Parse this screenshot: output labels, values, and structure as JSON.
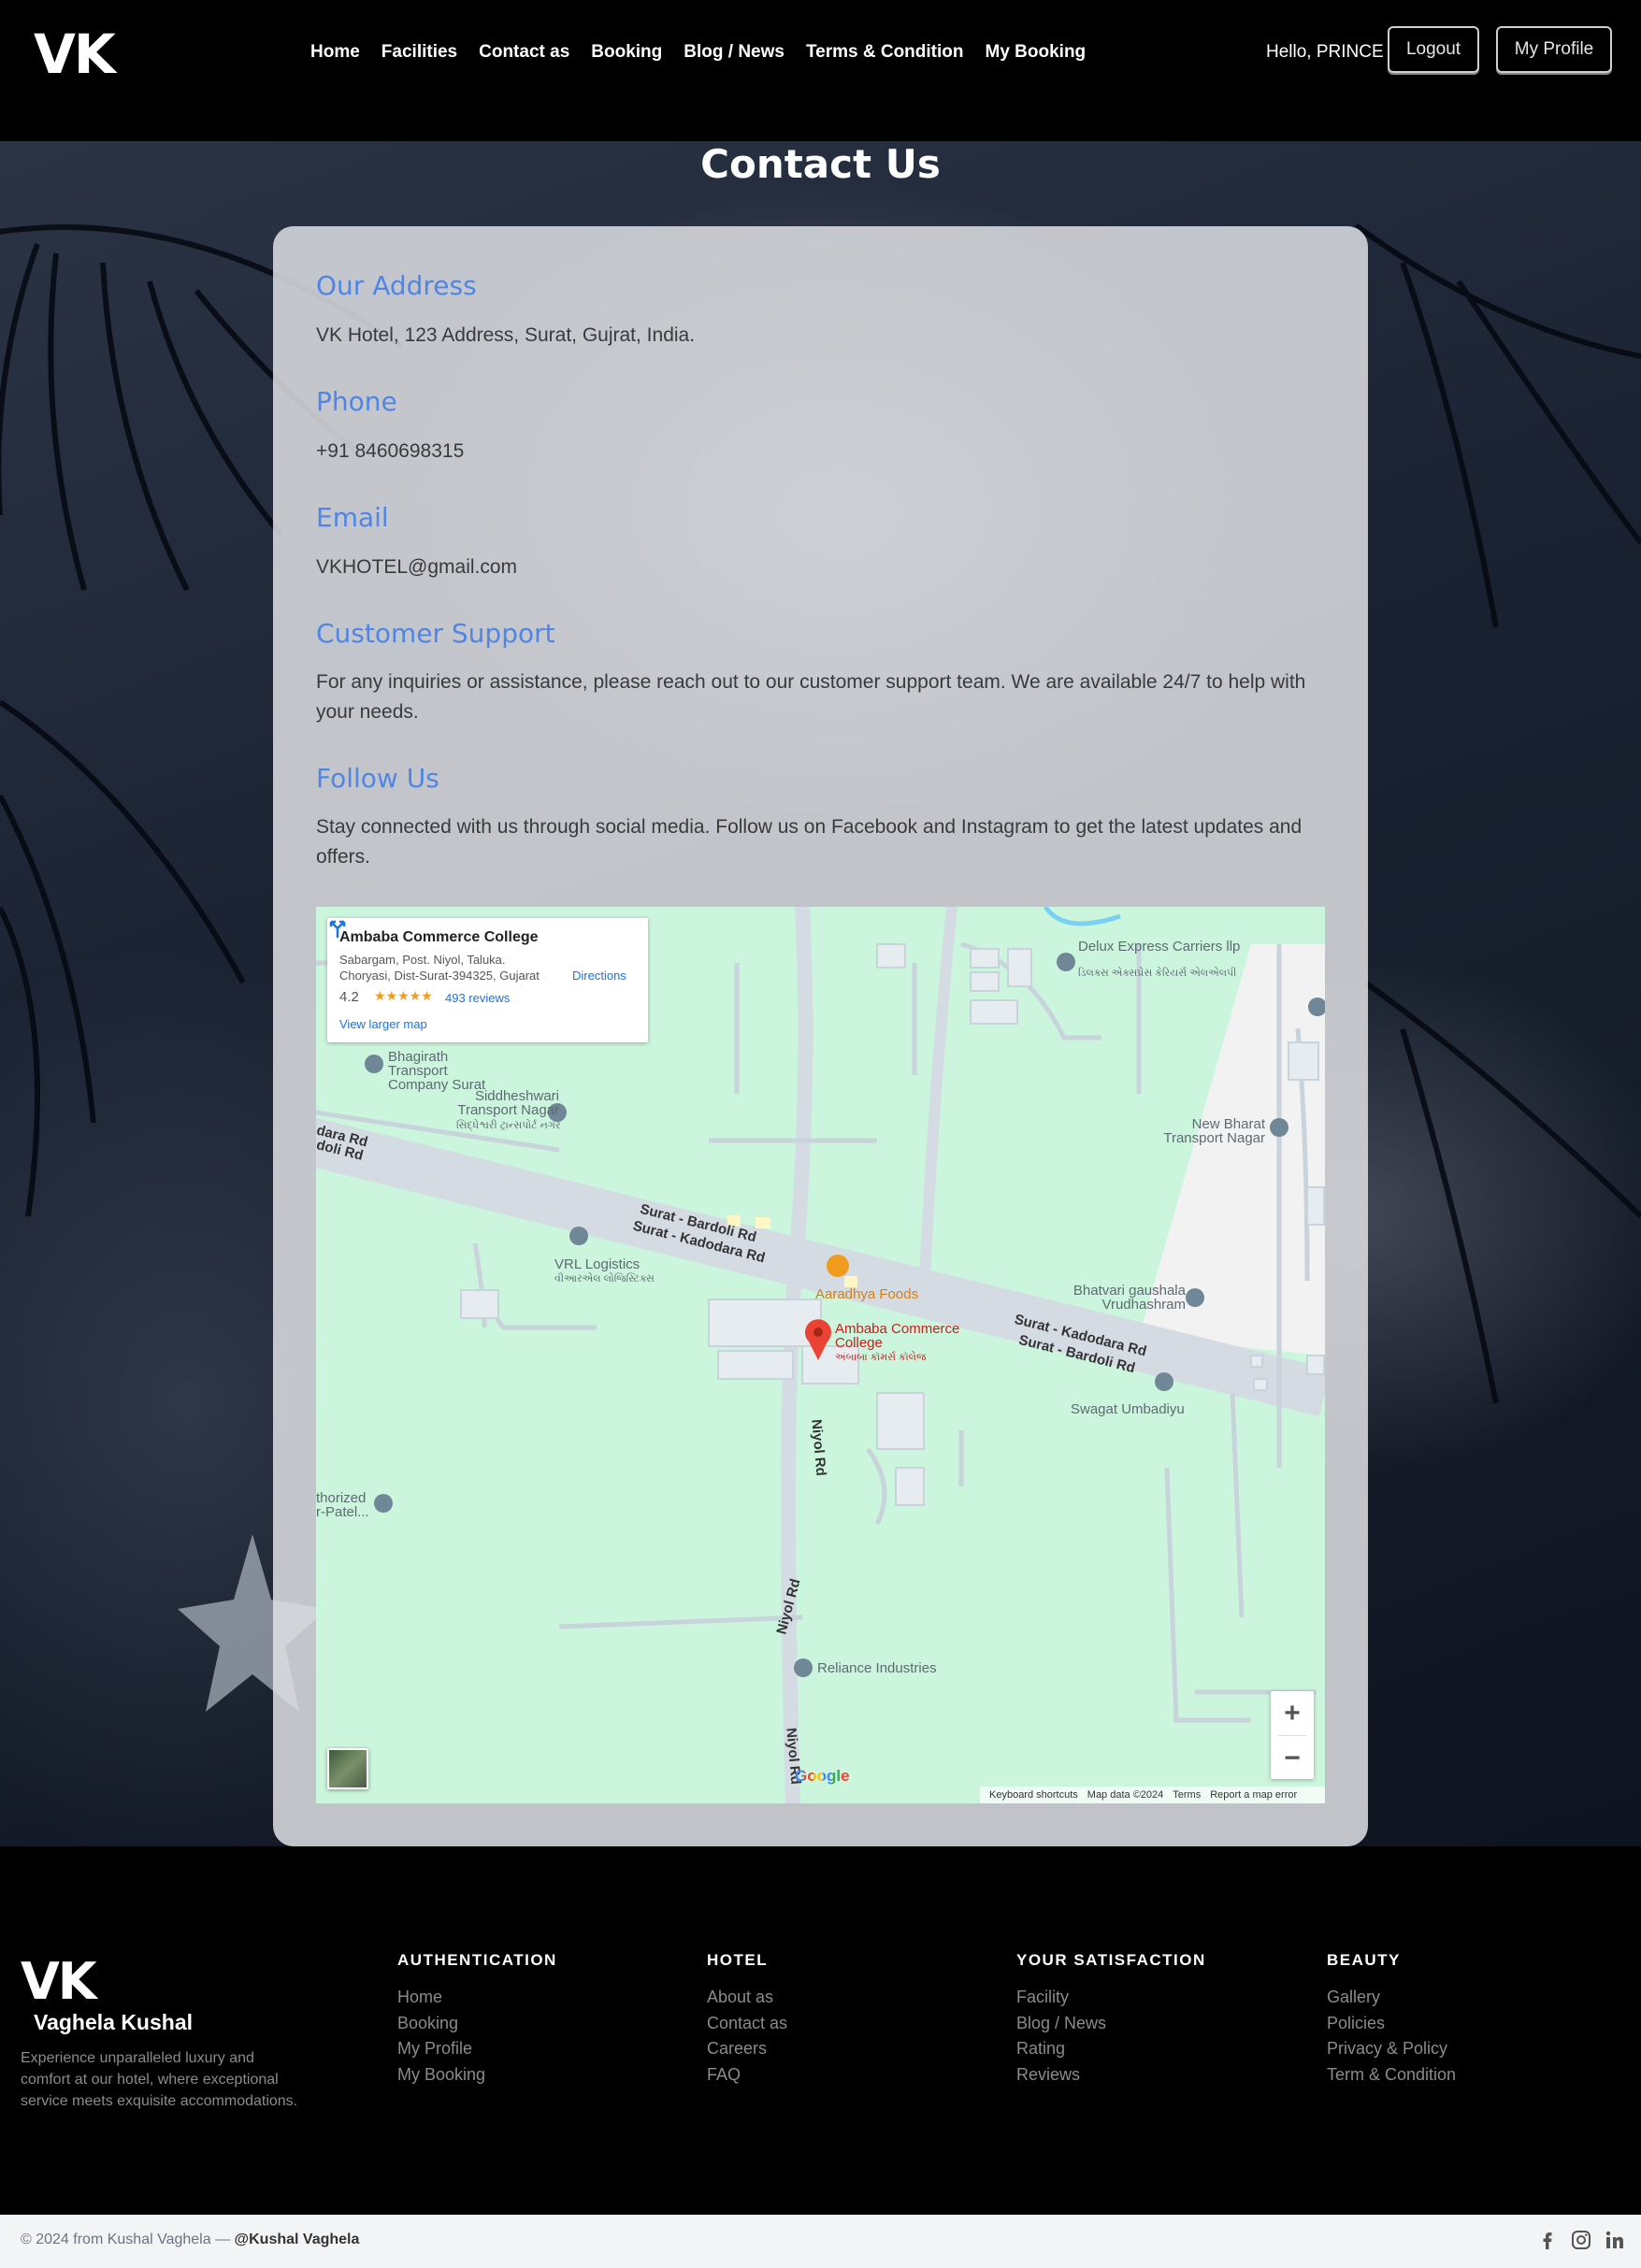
{
  "header": {
    "logo": "VK",
    "nav": [
      "Home",
      "Facilities",
      "Contact as",
      "Booking",
      "Blog / News",
      "Terms & Condition",
      "My Booking"
    ],
    "greeting": "Hello, PRINCE",
    "logout_label": "Logout",
    "profile_label": "My Profile"
  },
  "page": {
    "title": "Contact Us",
    "sections": [
      {
        "heading": "Our Address",
        "text": "VK Hotel, 123 Address, Surat, Gujrat, India."
      },
      {
        "heading": "Phone",
        "text": "+91 8460698315"
      },
      {
        "heading": "Email",
        "text": "VKHOTEL@gmail.com"
      },
      {
        "heading": "Customer Support",
        "text": "For any inquiries or assistance, please reach out to our customer support team. We are available 24/7 to help with your needs."
      },
      {
        "heading": "Follow Us",
        "text": "Stay connected with us through social media. Follow us on Facebook and Instagram to get the latest updates and offers."
      }
    ]
  },
  "map": {
    "place_name": "Ambaba Commerce College",
    "address": "Sabargam, Post. Niyol, Taluka. Choryasi, Dist-Surat-394325, Gujarat",
    "rating": "4.2",
    "stars": "★★★★★",
    "reviews": "493 reviews",
    "view_larger": "View larger map",
    "directions": "Directions",
    "labels": {
      "delux": "Delux Express Carriers llp",
      "delux_gu": "ડિલક્સ એક્સપ્રેસ કેરિયર્સ એલએલપી",
      "bhagirath": "Bhagirath Transport Company Surat",
      "siddheshwari": "Siddheshwari Transport Nagar",
      "siddheshwari_gu": "સિદ્ધેશ્વરી ટ્રાન્સપોર્ટ નગર",
      "newbharat": "New Bharat Transport Nagar",
      "vrl": "VRL Logistics",
      "vrl_gu": "વીઆરએલ લોજિસ્ટિક્સ",
      "aaradhya": "Aaradhya Foods",
      "bhatvari": "Bhatvari gaushala Vrudhashram",
      "college": "Ambaba Commerce College",
      "college_gu": "અંબાબા કૉમર્સ કૉલેજ",
      "swagat": "Swagat Umbadiyu",
      "authorized": "thorized r-Patel...",
      "reliance": "Reliance Industries",
      "road1": "Surat - Bardoli Rd",
      "road2": "Surat - Kadodara Rd",
      "road3": "Surat - Kadodara Rd",
      "road4": "Surat - Bardoli Rd",
      "road_left1": "dara Rd",
      "road_left2": "doli Rd",
      "niyol1": "Niyol Rd",
      "niyol2": "Niyol Rd",
      "niyol3": "Niyol Rd"
    },
    "zoom_in": "+",
    "zoom_out": "−",
    "google": "Google",
    "attribution": [
      "Keyboard shortcuts",
      "Map data ©2024",
      "Terms",
      "Report a map error"
    ]
  },
  "footer": {
    "logo": "VK",
    "name": "Vaghela Kushal",
    "description": "Experience unparalleled luxury and comfort at our hotel, where exceptional service meets exquisite accommodations.",
    "columns": [
      {
        "title": "AUTHENTICATION",
        "links": [
          "Home",
          "Booking",
          "My Profile",
          "My Booking"
        ]
      },
      {
        "title": "HOTEL",
        "links": [
          "About as",
          "Contact as",
          "Careers",
          "FAQ"
        ]
      },
      {
        "title": "YOUR SATISFACTION",
        "links": [
          "Facility",
          "Blog / News",
          "Rating",
          "Reviews"
        ]
      },
      {
        "title": "BEAUTY",
        "links": [
          "Gallery",
          "Policies",
          "Privacy & Policy",
          "Term & Condition"
        ]
      }
    ],
    "copyright": "© 2024 from Kushal Vaghela —",
    "handle": "@Kushal Vaghela",
    "social_icons": [
      "facebook-icon",
      "instagram-icon",
      "linkedin-icon"
    ]
  },
  "colors": {
    "heading_blue": "#4f86e6",
    "map_green": "#cbf5dd",
    "pin_red": "#ea4335"
  }
}
